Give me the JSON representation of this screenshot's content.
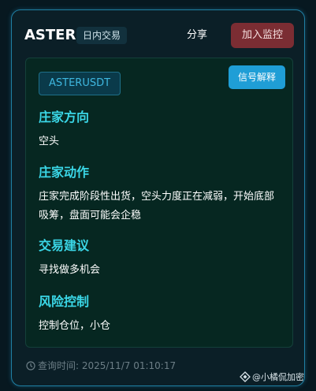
{
  "header": {
    "symbol": "ASTER",
    "tag": "日内交易",
    "share_label": "分享",
    "watch_label": "加入监控"
  },
  "panel": {
    "pair": "ASTERUSDT",
    "explain_label": "信号解释",
    "sections": [
      {
        "title": "庄家方向",
        "text": "空头"
      },
      {
        "title": "庄家动作",
        "text": "庄家完成阶段性出货，空头力度正在减弱，开始底部吸筹，盘面可能会企稳"
      },
      {
        "title": "交易建议",
        "text": "寻找做多机会"
      },
      {
        "title": "风险控制",
        "text": "控制仓位，小仓"
      }
    ]
  },
  "footer": {
    "query_time": "查询时间: 2025/11/7 01:10:17",
    "icon": "clock-icon"
  },
  "watermark": {
    "text": "@小橘侃加密",
    "icon": "brand-diamond-icon"
  },
  "colors": {
    "accent": "#3ad6e6",
    "button_primary": "#1f9ed6",
    "button_watch": "#7b2d33",
    "border": "#1f7fa3"
  }
}
